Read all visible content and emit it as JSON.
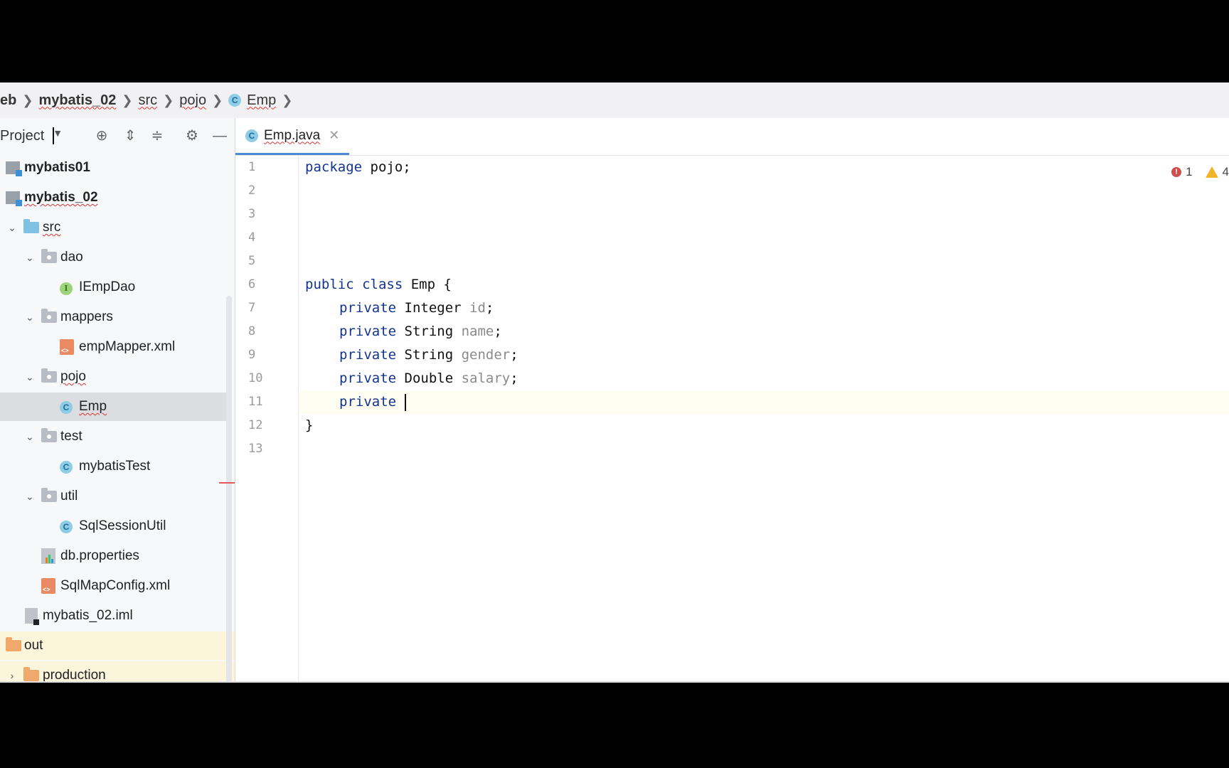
{
  "breadcrumb": [
    {
      "label": "eb",
      "bold": true
    },
    {
      "label": "mybatis_02",
      "bold": true
    },
    {
      "label": "src"
    },
    {
      "label": "pojo"
    },
    {
      "label": "Emp",
      "icon": "class-icon"
    }
  ],
  "panel": {
    "title": "Project",
    "tools": [
      "locate-icon",
      "expand-all-icon",
      "collapse-all-icon",
      "gear-icon",
      "minimize-icon"
    ]
  },
  "tree": [
    {
      "label": "mybatis01",
      "bold": true,
      "icon": "module-icon",
      "depth": 0
    },
    {
      "label": "mybatis_02",
      "bold": true,
      "icon": "module-icon",
      "depth": 0
    },
    {
      "label": "src",
      "icon": "source-folder-icon",
      "depth": 1,
      "expanded": true
    },
    {
      "label": "dao",
      "icon": "package-icon",
      "depth": 2,
      "expanded": true
    },
    {
      "label": "IEmpDao",
      "icon": "interface-icon",
      "depth": 3
    },
    {
      "label": "mappers",
      "icon": "package-icon",
      "depth": 2,
      "expanded": true
    },
    {
      "label": "empMapper.xml",
      "icon": "xml-file-icon",
      "depth": 3
    },
    {
      "label": "pojo",
      "icon": "package-icon",
      "depth": 2,
      "expanded": true
    },
    {
      "label": "Emp",
      "icon": "class-icon",
      "depth": 3,
      "selected": true
    },
    {
      "label": "test",
      "icon": "package-icon",
      "depth": 2,
      "expanded": true
    },
    {
      "label": "mybatisTest",
      "icon": "class-icon",
      "depth": 3
    },
    {
      "label": "util",
      "icon": "package-icon",
      "depth": 2,
      "expanded": true
    },
    {
      "label": "SqlSessionUtil",
      "icon": "class-icon",
      "depth": 3
    },
    {
      "label": "db.properties",
      "icon": "properties-file-icon",
      "depth": 2
    },
    {
      "label": "SqlMapConfig.xml",
      "icon": "xml-file-icon",
      "depth": 2
    },
    {
      "label": "mybatis_02.iml",
      "icon": "iml-file-icon",
      "depth": 1
    },
    {
      "label": "out",
      "icon": "excluded-folder-icon",
      "depth": 0
    },
    {
      "label": "production",
      "icon": "excluded-folder-icon",
      "depth": 1,
      "expanded": false
    }
  ],
  "editor": {
    "tab": {
      "label": "Emp.java",
      "icon": "class-icon"
    },
    "inspections": {
      "errors": "1",
      "warnings": "4"
    },
    "lines": [
      "1",
      "2",
      "3",
      "4",
      "5",
      "6",
      "7",
      "8",
      "9",
      "10",
      "11",
      "12",
      "13"
    ],
    "code": {
      "l1_kw": "package",
      "l1_rest": " pojo;",
      "l6_kw": "public class",
      "l6_rest": " Emp {",
      "l7_kw": "private",
      "l7_type": " Integer ",
      "l7_field": "id",
      "l7_end": ";",
      "l8_kw": "private",
      "l8_type": " String ",
      "l8_field": "name",
      "l8_end": ";",
      "l9_kw": "private",
      "l9_type": " String ",
      "l9_field": "gender",
      "l9_end": ";",
      "l10_kw": "private",
      "l10_type": " Double ",
      "l10_field": "salary",
      "l10_end": ";",
      "l11_kw": "private",
      "l12": "}"
    }
  }
}
